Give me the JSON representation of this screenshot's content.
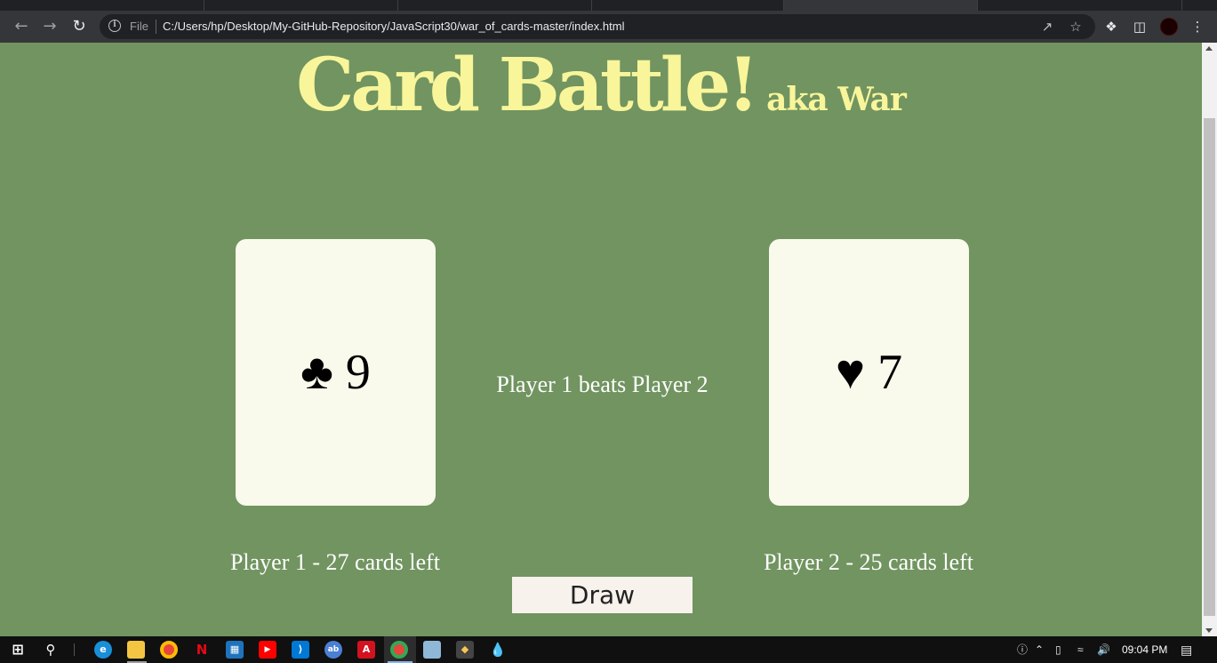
{
  "browser": {
    "address_scheme": "File",
    "address_url": "C:/Users/hp/Desktop/My-GitHub-Repository/JavaScript30/war_of_cards-master/index.html",
    "icons": {
      "back": "arrow-left-icon",
      "forward": "arrow-right-icon",
      "reload": "reload-icon",
      "info": "info-icon",
      "share": "share-icon",
      "bookmark": "star-icon",
      "extensions": "puzzle-icon",
      "side_panel": "side-panel-icon",
      "menu": "kebab-menu-icon"
    }
  },
  "page": {
    "title_main": "Card Battle!",
    "title_sub": "aka War",
    "player1_card": {
      "suit": "♣",
      "rank": "9"
    },
    "player2_card": {
      "suit": "♥",
      "rank": "7"
    },
    "result_text": "Player 1 beats Player 2",
    "player1_count": "Player 1 - 27 cards left",
    "player2_count": "Player 2 - 25 cards left",
    "draw_label": "Draw",
    "colors": {
      "background": "#719460",
      "title": "#f8f59a",
      "card": "#f9f9ec",
      "button": "#f7f2ec"
    }
  },
  "taskbar": {
    "apps": [
      "windows-start-icon",
      "search-icon",
      "edge-icon",
      "file-explorer-icon",
      "chrome-icon",
      "netflix-icon",
      "store-icon",
      "youtube-icon",
      "vscode-icon",
      "app-icon",
      "acrobat-icon",
      "chrome-active-icon",
      "notepad-icon",
      "git-icon",
      "paint-drop-icon"
    ],
    "clock": "09:04 PM"
  }
}
